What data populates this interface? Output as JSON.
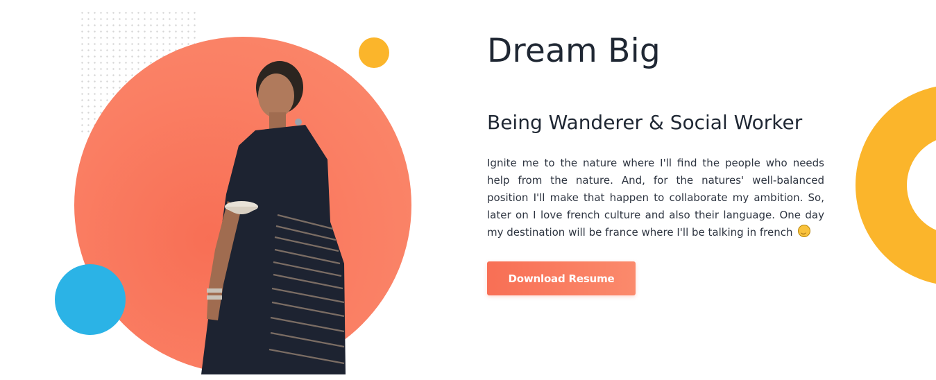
{
  "hero": {
    "title": "Dream Big",
    "subtitle": "Being Wanderer & Social Worker",
    "bio": "Ignite me to the nature where I'll find the people who needs help from the nature. And, for the natures' well-balanced position I'll make that happen to collaborate my ambition. So, later on I love french culture and also their language. One day my destination will be france where I'll be talking in french",
    "emoji_icon": "smiling-face-emoji",
    "download_label": "Download Resume"
  },
  "colors": {
    "accent": "#f86f55",
    "accent_light": "#fb8a6c",
    "yellow": "#fbb52b",
    "blue": "#2bb3e6",
    "heading": "#1f2733"
  }
}
